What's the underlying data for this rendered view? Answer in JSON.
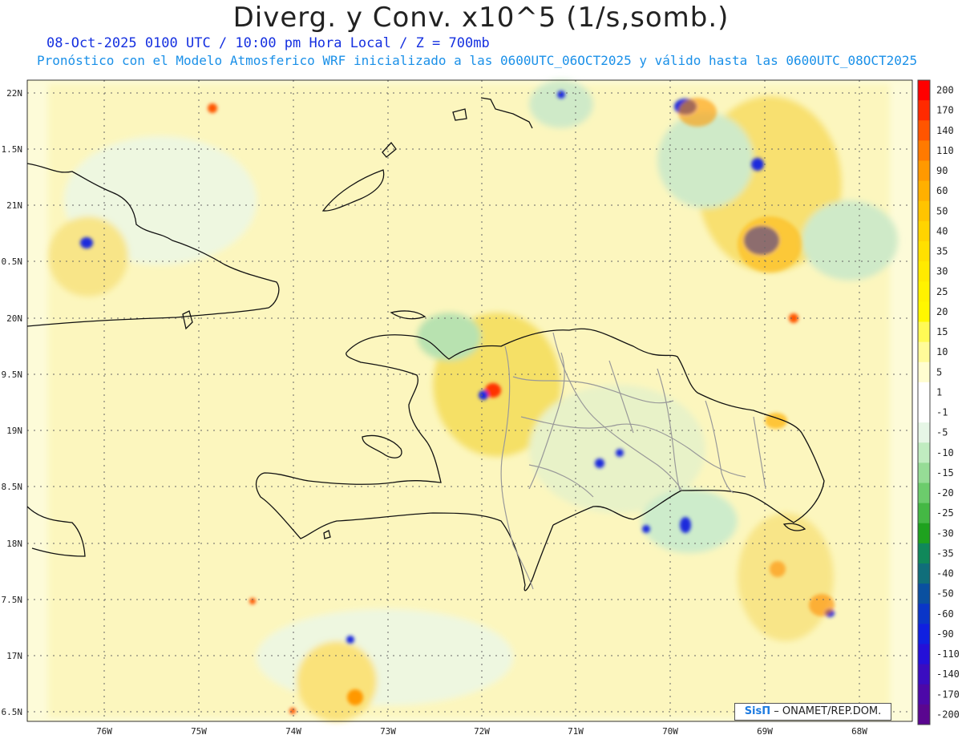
{
  "title": "Diverg. y Conv. x10^5 (1/s,somb.)",
  "subtitle_1": "08-Oct-2025  0100 UTC / 10:00 pm Hora Local / Z = 700mb",
  "subtitle_2": "Pronóstico con el Modelo Atmosferico WRF inicializado a las 0600UTC_06OCT2025 y válido hasta las  0600UTC_08OCT2025",
  "credit": {
    "logo": "SisΠ",
    "text": "– ONAMET/REP.DOM."
  },
  "lat_labels": [
    "22N",
    "1.5N",
    "21N",
    "0.5N",
    "20N",
    "9.5N",
    "19N",
    "8.5N",
    "18N",
    "7.5N",
    "17N",
    "6.5N"
  ],
  "lon_labels": [
    "76W",
    "75W",
    "74W",
    "73W",
    "72W",
    "71W",
    "70W",
    "69W",
    "68W"
  ],
  "colorbar": {
    "labels": [
      "200",
      "170",
      "140",
      "110",
      "90",
      "60",
      "50",
      "40",
      "35",
      "30",
      "25",
      "20",
      "15",
      "10",
      "5",
      "1",
      "-1",
      "-5",
      "-10",
      "-15",
      "-20",
      "-25",
      "-30",
      "-35",
      "-40",
      "-50",
      "-60",
      "-90",
      "-110",
      "-140",
      "-170",
      "-200"
    ],
    "colors": [
      "#ff0000",
      "#ff2a00",
      "#ff5500",
      "#ff7a00",
      "#ff9900",
      "#ffb000",
      "#ffc400",
      "#ffd400",
      "#ffe000",
      "#ffea00",
      "#fff200",
      "#fff700",
      "#fffa55",
      "#fffb99",
      "#fffdd0",
      "#ffffff",
      "#ffffff",
      "#e6f6e6",
      "#c0ecc0",
      "#96dc96",
      "#6ccc6c",
      "#44b844",
      "#1ea21e",
      "#10885a",
      "#106e7a",
      "#0a50a0",
      "#0a36c8",
      "#1020e0",
      "#2410d8",
      "#3a0cc0",
      "#4c08a8",
      "#5a0690"
    ]
  }
}
